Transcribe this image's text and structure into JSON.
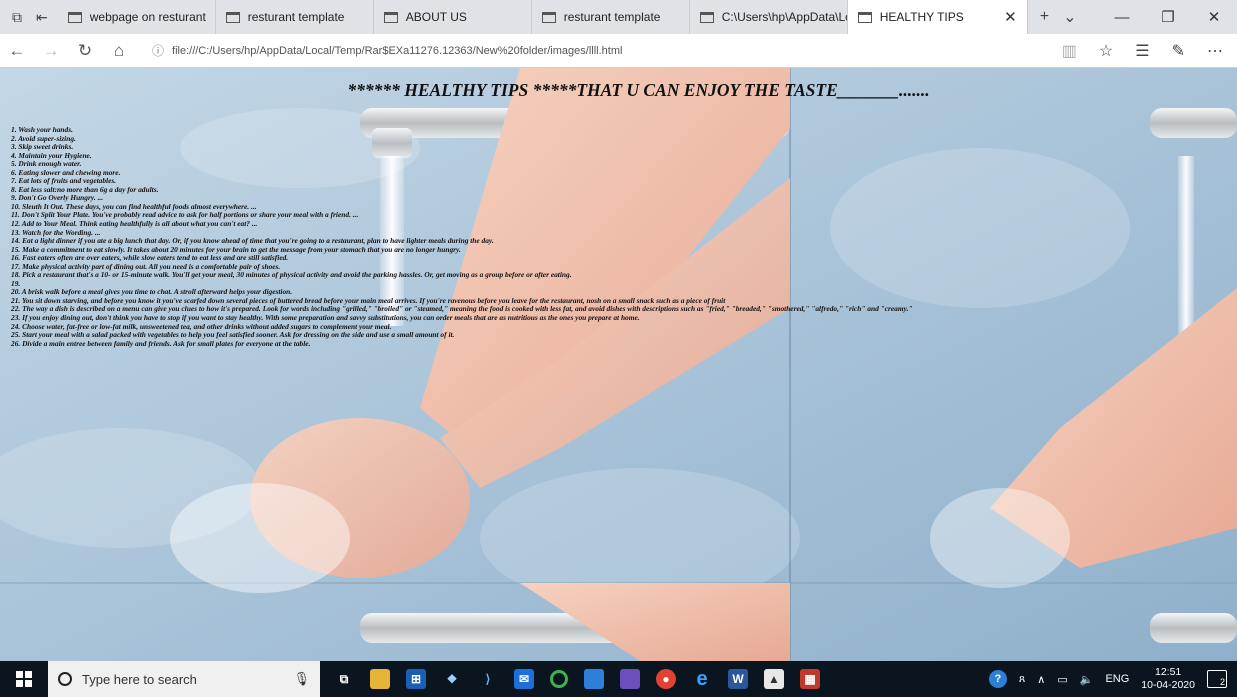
{
  "browser": {
    "tabs": [
      {
        "label": "webpage on resturant"
      },
      {
        "label": "resturant template"
      },
      {
        "label": "ABOUT US"
      },
      {
        "label": "resturant template"
      },
      {
        "label": "C:\\Users\\hp\\AppData\\Local\\"
      },
      {
        "label": "HEALTHY TIPS",
        "active": true
      }
    ],
    "address": "file:///C:/Users/hp/AppData/Local/Temp/Rar$EXa11276.12363/New%20folder/images/llll.html",
    "icons": [
      "back-icon",
      "forward-icon",
      "refresh-icon",
      "home-icon",
      "info-icon",
      "reading-view-icon",
      "favorite-star-icon",
      "favorites-hub-icon",
      "pen-icon",
      "more-icon"
    ]
  },
  "page": {
    "title": "****** HEALTHY TIPS *****THAT U CAN ENJOY THE TASTE_______.......",
    "background": "faucet-and-washing-hands photo (tiled, 123RF watermark)",
    "tips": [
      "1. Wash your hands.",
      "2. Avoid super-sizing.",
      "3. Skip sweet drinks.",
      "4. Maintain your Hygiene.",
      "5. Drink enough water.",
      "6. Eating slower and chewing more.",
      "7. Eat lots of fruits and vegetables.",
      "8. Eat less salt:no more than 6g a day for adults.",
      "9. Don't Go Overly Hungry. ...",
      "10. Sleuth It Out. These days, you can find healthful foods almost everywhere. ...",
      "11. Don't Split Your Plate. You've probably read advice to ask for half portions or share your meal with a friend. ...",
      "12. Add to Your Meal. Think eating healthfully is all about what you can't eat? ...",
      "13. Watch for the Wording. ...",
      "14. Eat a light dinner if you ate a big lunch that day. Or, if you know ahead of time that you're going to a restaurant, plan to have lighter meals during the day.",
      "15. Make a commitment to eat slowly. It takes about 20 minutes for your brain to get the message from your stomach that you are no longer hungry.",
      "16. Fast eaters often are over eaters, while slow eaters tend to eat less and are still satisfied.",
      "17. Make physical activity part of dining out. All you need is a comfortable pair of shoes.",
      "18. Pick a restaurant that's a 10- or 15-minute walk. You'll get your meal, 30 minutes of physical activity and avoid the parking hassles. Or, get moving as a group before or after eating.",
      "19.",
      "20. A brisk walk before a meal gives you time to chat. A stroll afterward helps your digestion.",
      "21. You sit down starving, and before you know it you've scarfed down several pieces of buttered bread before your main meal arrives. If you're ravenous before you leave for the restaurant, nosh on a small snack such as a piece of fruit",
      "22. The way a dish is described on a menu can give you clues to how it's prepared. Look for words including \"grilled,\" \"broiled\" or \"steamed,\" meaning the food is cooked with less fat, and avoid dishes with descriptions such as \"fried,\" \"breaded,\" \"smothered,\" \"alfredo,\" \"rich\" and \"creamy.\"",
      "23. If you enjoy dining out, don't think you have to stop if you want to stay healthy. With some preparation and savvy substitutions, you can order meals that are as nutritious as the ones you prepare at home.",
      "24. Choose water, fat-free or low-fat milk, unsweetened tea, and other drinks without added sugars to complement your meal.",
      "25. Start your meal with a salad packed with vegetables to help you feel satisfied sooner. Ask for dressing on the side and use a small amount of it.",
      "26. Divide a main entree between family and friends. Ask for small plates for everyone at the table."
    ]
  },
  "taskbar": {
    "search_placeholder": "Type here to search",
    "language": "ENG",
    "time": "12:51",
    "date": "10-04-2020",
    "notification_count": "2"
  }
}
